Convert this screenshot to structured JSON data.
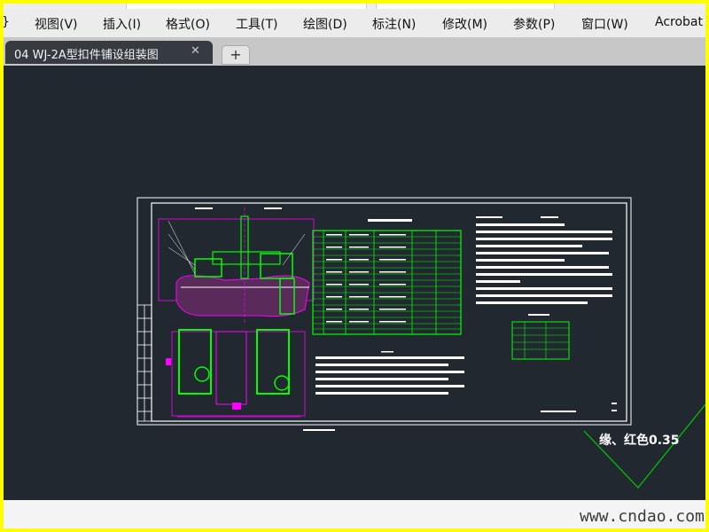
{
  "menu": {
    "items": [
      {
        "label": "视图(V)"
      },
      {
        "label": "插入(I)"
      },
      {
        "label": "格式(O)"
      },
      {
        "label": "工具(T)"
      },
      {
        "label": "绘图(D)"
      },
      {
        "label": "标注(N)"
      },
      {
        "label": "修改(M)"
      },
      {
        "label": "参数(P)"
      },
      {
        "label": "窗口(W)"
      },
      {
        "label": "Acrobat"
      }
    ],
    "cut_prefix": "}"
  },
  "tabs": {
    "active_label": "04 WJ-2A型扣件铺设组装图",
    "close_glyph": "✕",
    "new_tab_glyph": "+"
  },
  "drawing": {
    "annotation": "缘、红色0.35",
    "colors": {
      "background": "#212830",
      "frame": "#ffffff",
      "green": "#00ff00",
      "magenta": "#ff00ff",
      "annotation_line": "#00cc00"
    }
  },
  "watermark": "www.cndao.com"
}
